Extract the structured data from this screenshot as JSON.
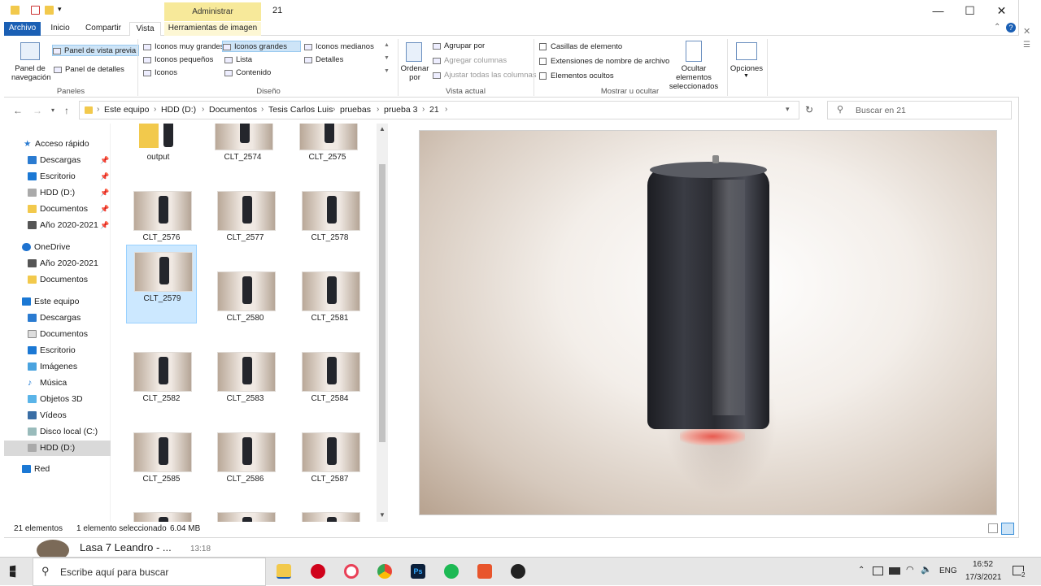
{
  "window": {
    "title": "21",
    "context_tab": "Administrar",
    "minimize": "—",
    "maximize": "☐",
    "close": "✕"
  },
  "tabs": [
    "Archivo",
    "Inicio",
    "Compartir",
    "Vista",
    "Herramientas de imagen"
  ],
  "ribbon": {
    "paneles": {
      "label": "Paneles",
      "nav_pane": "Panel de navegación",
      "preview_pane": "Panel de vista previa",
      "details_pane": "Panel de detalles"
    },
    "diseno": {
      "label": "Diseño",
      "items": [
        "Iconos muy grandes",
        "Iconos grandes",
        "Iconos medianos",
        "Iconos pequeños",
        "Lista",
        "Detalles",
        "Iconos",
        "Contenido"
      ]
    },
    "vista_actual": {
      "label": "Vista actual",
      "ordenar": "Ordenar por",
      "agrupar": "Agrupar por",
      "agregar": "Agregar columnas",
      "ajustar": "Ajustar todas las columnas"
    },
    "mostrar": {
      "label": "Mostrar u ocultar",
      "casillas": "Casillas de elemento",
      "extensiones": "Extensiones de nombre de archivo",
      "ocultos": "Elementos ocultos",
      "ocultar_sel": "Ocultar elementos seleccionados"
    },
    "opciones": "Opciones"
  },
  "breadcrumb": [
    "Este equipo",
    "HDD (D:)",
    "Documentos",
    "Tesis Carlos Luis",
    "pruebas",
    "prueba 3",
    "21"
  ],
  "search_placeholder": "Buscar en 21",
  "nav": {
    "quick": "Acceso rápido",
    "quick_items": [
      "Descargas",
      "Escritorio",
      "HDD (D:)",
      "Documentos",
      "Año 2020-2021"
    ],
    "onedrive": "OneDrive",
    "onedrive_items": [
      "Año 2020-2021",
      "Documentos"
    ],
    "pc": "Este equipo",
    "pc_items": [
      "Descargas",
      "Documentos",
      "Escritorio",
      "Imágenes",
      "Música",
      "Objetos 3D",
      "Vídeos",
      "Disco local (C:)",
      "HDD (D:)"
    ],
    "network": "Red"
  },
  "files": [
    "output",
    "CLT_2574",
    "CLT_2575",
    "CLT_2576",
    "CLT_2577",
    "CLT_2578",
    "CLT_2579",
    "CLT_2580",
    "CLT_2581",
    "CLT_2582",
    "CLT_2583",
    "CLT_2584",
    "CLT_2585",
    "CLT_2586",
    "CLT_2587"
  ],
  "selected_file": "CLT_2579",
  "status": {
    "count": "21 elementos",
    "selected": "1 elemento seleccionado",
    "size": "6.04 MB"
  },
  "notification": {
    "text": "Lasa 7 Leandro - ...",
    "time": "13:18"
  },
  "taskbar": {
    "search": "Escribe aquí para buscar",
    "lang": "ENG",
    "time": "16:52",
    "date": "17/3/2021",
    "notif_count": "2"
  }
}
